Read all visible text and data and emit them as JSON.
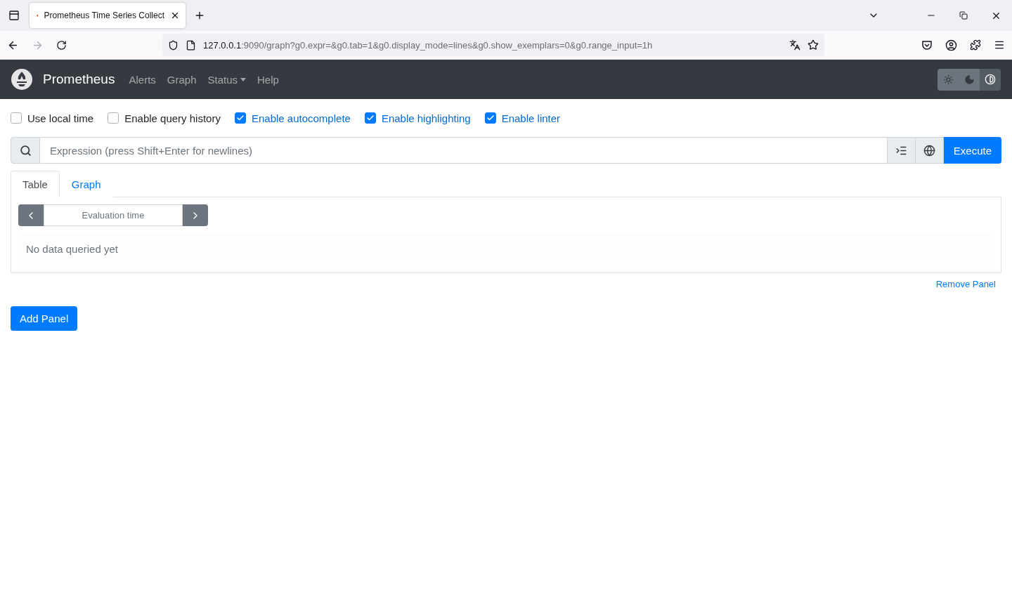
{
  "browser": {
    "tab_title": "Prometheus Time Series Collect",
    "url_host": "127.0.0.1",
    "url_path": ":9090/graph?g0.expr=&g0.tab=1&g0.display_mode=lines&g0.show_exemplars=0&g0.range_input=1h"
  },
  "navbar": {
    "brand": "Prometheus",
    "links": [
      {
        "label": "Alerts",
        "kind": "link"
      },
      {
        "label": "Graph",
        "kind": "link"
      },
      {
        "label": "Status",
        "kind": "dropdown"
      },
      {
        "label": "Help",
        "kind": "link"
      }
    ],
    "theme_buttons": [
      {
        "kind": "light",
        "selected": false
      },
      {
        "kind": "dark",
        "selected": false
      },
      {
        "kind": "auto",
        "selected": true
      }
    ]
  },
  "options": [
    {
      "label": "Use local time",
      "checked": false
    },
    {
      "label": "Enable query history",
      "checked": false
    },
    {
      "label": "Enable autocomplete",
      "checked": true
    },
    {
      "label": "Enable highlighting",
      "checked": true
    },
    {
      "label": "Enable linter",
      "checked": true
    }
  ],
  "query": {
    "placeholder": "Expression (press Shift+Enter for newlines)",
    "execute": "Execute"
  },
  "panel": {
    "tabs": [
      {
        "label": "Table",
        "selected": true
      },
      {
        "label": "Graph",
        "selected": false
      }
    ],
    "evaluation_time": {
      "placeholder": "Evaluation time"
    },
    "message": "No data queried yet",
    "remove": "Remove Panel"
  },
  "add_panel": "Add Panel"
}
